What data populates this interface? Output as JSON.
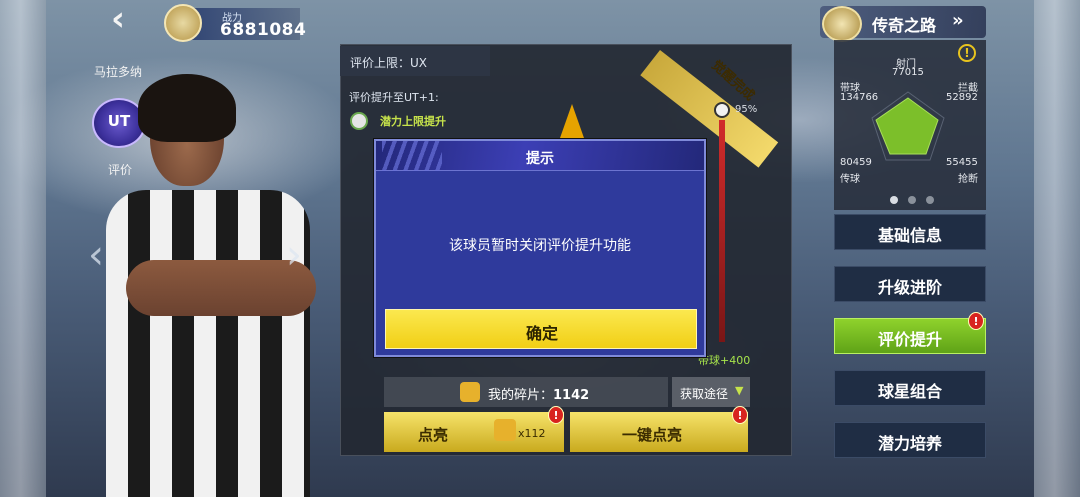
{
  "header": {
    "power_label": "战力",
    "power_value": "6881084",
    "legend_title": "传奇之路",
    "legend_arrow": "»"
  },
  "player": {
    "name": "马拉多纳",
    "rating_badge": "UT",
    "rating_label": "评价"
  },
  "panel": {
    "limit_label": "评价上限：UX",
    "upgrade_label": "评价提升至UT+1:",
    "potential_label": "潜力上限提升",
    "ribbon": "觉醒完成",
    "progress_percent": "95%",
    "bonus": "带球+400",
    "fragments_label": "我的碎片：",
    "fragments_value": "1142",
    "obtain": "获取途径",
    "light_button": "点亮",
    "light_count": "x112",
    "onekey_button": "一键点亮"
  },
  "dialog": {
    "title": "提示",
    "message": "该球员暂时关闭评价提升功能",
    "confirm": "确定"
  },
  "stats": {
    "shoot_label": "射门",
    "shoot_value": "77015",
    "dribble_label": "带球",
    "dribble_value": "134766",
    "intercept_label": "拦截",
    "intercept_value": "52892",
    "pass_label": "传球",
    "pass_value": "80459",
    "tackle_label": "抢断",
    "tackle_value": "55455"
  },
  "menu": {
    "items": [
      {
        "label": "基础信息"
      },
      {
        "label": "升级进阶"
      },
      {
        "label": "评价提升"
      },
      {
        "label": "球星组合"
      },
      {
        "label": "潜力培养"
      }
    ],
    "active_index": 2
  },
  "colors": {
    "accent_yellow": "#f1cf15",
    "active_green": "#8fd22c",
    "dialog_blue": "#2f3a9c",
    "alert_red": "#d8241f"
  }
}
